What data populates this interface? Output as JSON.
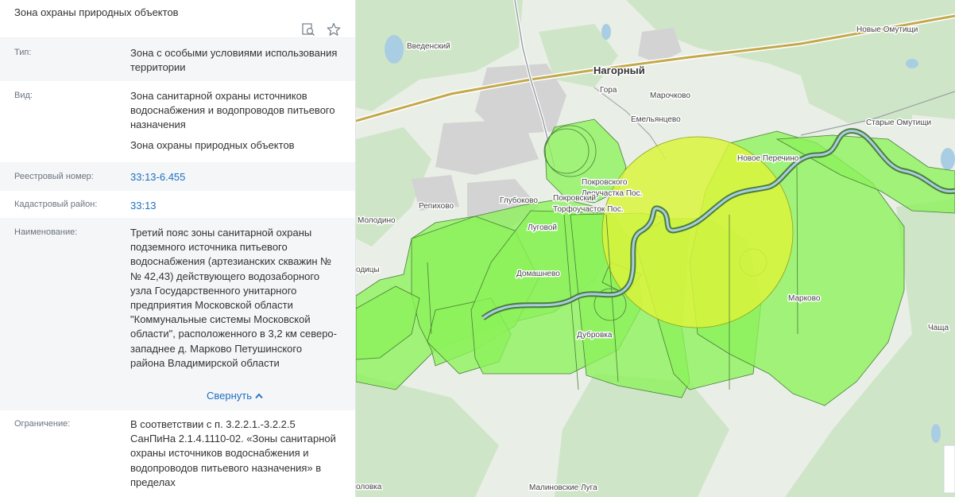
{
  "panel": {
    "title": "Зона охраны природных объектов",
    "icons": [
      "search-doc-icon",
      "star-icon"
    ],
    "fields": {
      "type_label": "Тип:",
      "type_value": "Зона с особыми условиями использования территории",
      "kind_label": "Вид:",
      "kind_value_1": "Зона санитарной охраны источников водоснабжения и водопроводов питьевого назначения",
      "kind_value_2": "Зона охраны природных объектов",
      "reg_label": "Реестровый номер:",
      "reg_value": "33:13-6.455",
      "cad_label": "Кадастровый район:",
      "cad_value": "33:13",
      "name_label": "Наименование:",
      "name_value": "Третий пояс зоны санитарной охраны подземного источника питьевого водоснабжения (артезианских скважин №№ 42,43) действующего водозаборного узла Государственного унитарного предприятия Московской области \"Коммунальные системы Московской области\", расположенного в 3,2 км северо-западнее д. Марково Петушинского района Владимирской области",
      "collapse_label": "Свернуть",
      "restriction_label": "Ограничение:",
      "restriction_value": "В соответствии с п. 3.2.2.1.-3.2.2.5 СанПиНа 2.1.4.1110-02. «Зоны санитарной охраны источников водоснабжения и водопроводов питьевого назначения» в пределах"
    }
  },
  "map": {
    "labels": {
      "nagorny": "Нагорный",
      "vvedensky": "Введенский",
      "gora": "Гора",
      "marochkovo": "Марочково",
      "emelyantsevo": "Емельянцево",
      "novye_omutishchi": "Новые Омутищи",
      "starye_omutishchi": "Старые Омутищи",
      "novoe_perechino": "Новое Перечино",
      "pokrovsky_1": "Покровского",
      "pokrovsky_2": "Леоучастка Пос.",
      "pokrovsky_torf_1": "Покровский",
      "pokrovsky_torf_2": "Торфоучасток Пос.",
      "glubokovo": "Глубоково",
      "repikhovo": "Репихово",
      "molodino": "Молодино",
      "lugovoy": "Луговой",
      "domashnevo": "Домашнево",
      "dubrovka": "Дубровка",
      "markovo": "Марково",
      "chashcha": "Чаща",
      "malinovskie_luga": "Малиновские Луга",
      "loviditsy": "одицы",
      "golovka": "оловка"
    },
    "colors": {
      "base": "#e9efe6",
      "forest": "#cfe5c8",
      "zone_fill": "#8cf25a",
      "zone_stroke": "#4b7d3a",
      "highlight": "#d9f53c",
      "road": "#c3a84c",
      "urban": "#d3d3d3",
      "water": "#a9cde3"
    }
  }
}
